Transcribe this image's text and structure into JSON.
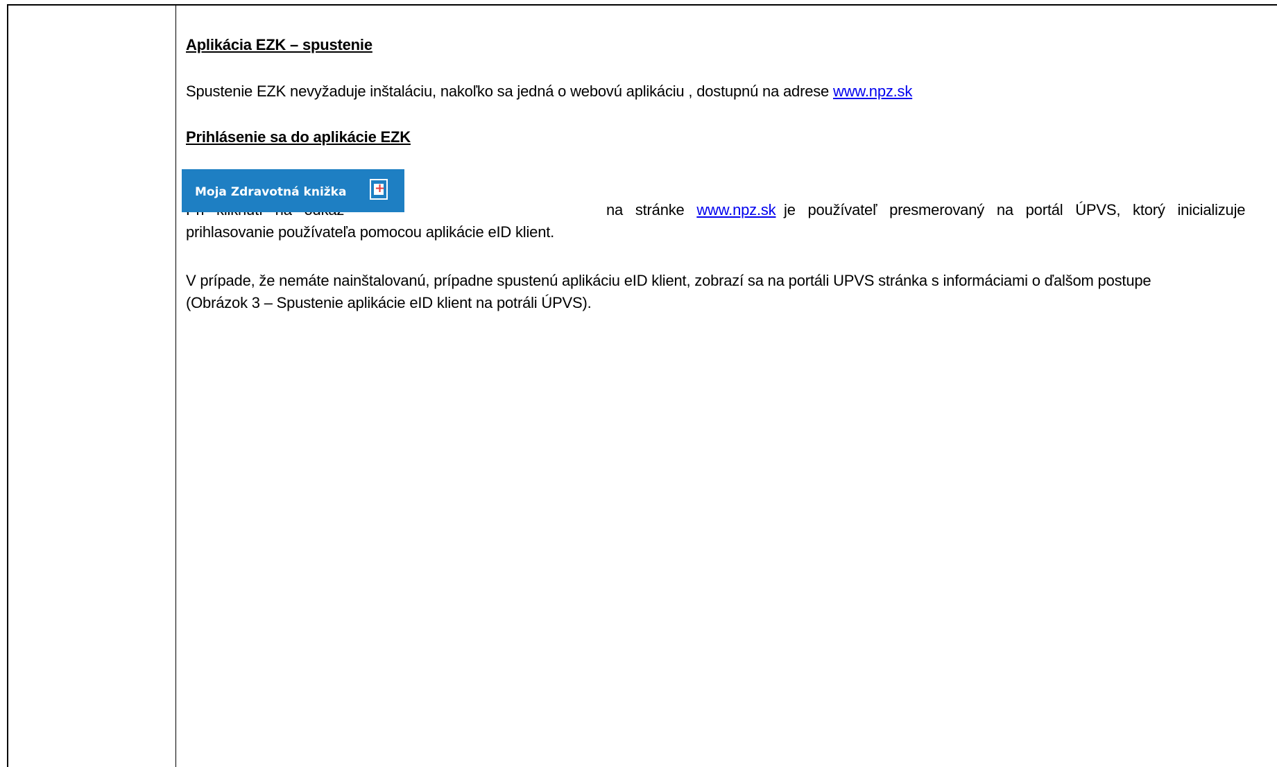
{
  "section1": {
    "heading": "Aplikácia EZK – spustenie",
    "text": "Spustenie EZK  nevyžaduje inštaláciu, nakoľko sa jedná o webovú aplikáciu , dostupnú na adrese ",
    "link": "www.npz.sk"
  },
  "section2": {
    "heading": "Prihlásenie sa do aplikácie EZK",
    "button_label": "Moja Zdravotná knižka",
    "button_icon": "health-book-icon",
    "line1_words": [
      "Pri",
      "kliknutí",
      "na",
      "odkaz"
    ],
    "line1_after": [
      "na",
      "stránke"
    ],
    "line1_link": "www.npz.sk",
    "line1_rest": [
      "je",
      "používateľ",
      "presmerovaný",
      "na",
      "portál",
      "ÚPVS,",
      "ktorý",
      "inicializuje"
    ],
    "line2": "prihlasovanie používateľa pomocou aplikácie eID klient.",
    "para2_line1": "V prípade, že nemáte nainštalovanú, prípadne spustenú aplikáciu eID klient, zobrazí sa na portáli UPVS stránka s informáciami o ďalšom postupe",
    "para2_line2": "(Obrázok 3 – Spustenie aplikácie eID klient na potráli ÚPVS)."
  },
  "colors": {
    "button_bg": "#1e7fc3",
    "link": "#0000ee",
    "icon_plus": "#e63b3b"
  }
}
